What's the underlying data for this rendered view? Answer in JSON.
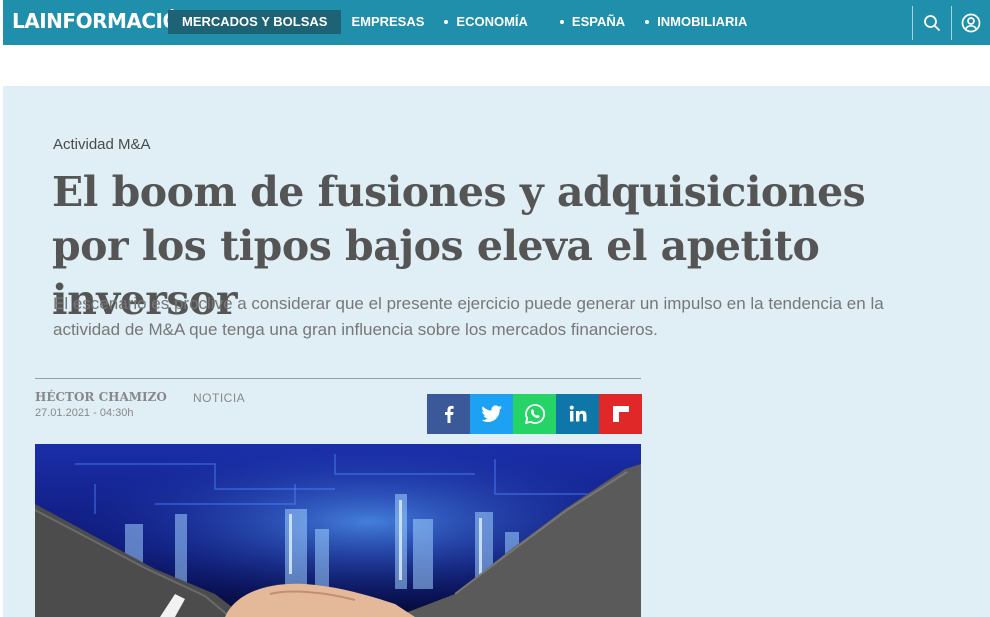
{
  "brand": {
    "logo_text": "LAINFORMACIÓN"
  },
  "nav": {
    "items": [
      {
        "label": "Mercados y Bolsas"
      },
      {
        "label": "Empresas"
      },
      {
        "label": "Economía"
      },
      {
        "label": "España"
      },
      {
        "label": "Inmobiliaria"
      }
    ]
  },
  "article": {
    "kicker": "Actividad M&A",
    "headline": "El boom de fusiones y adquisiciones por los tipos bajos eleva el apetito inversor",
    "summary": "El escenario es proclive a considerar que el presente ejercicio puede generar un impulso en la tendencia en la actividad de M&A que tenga una gran influencia sobre los mercados financieros.",
    "author": "HÉCTOR CHAMIZO",
    "type": "NOTICIA",
    "date": "27.01.2021 - 04:30h"
  },
  "share": [
    {
      "network": "facebook",
      "color": "#3b5998"
    },
    {
      "network": "twitter",
      "color": "#1da1f2"
    },
    {
      "network": "whatsapp",
      "color": "#25d366"
    },
    {
      "network": "linkedin",
      "color": "#0e76a8"
    },
    {
      "network": "flipboard",
      "color": "#e12828"
    }
  ],
  "colors": {
    "topbar": "#1f8fab",
    "active_nav": "#1e6275",
    "hero_bg": "#e0eff5"
  }
}
